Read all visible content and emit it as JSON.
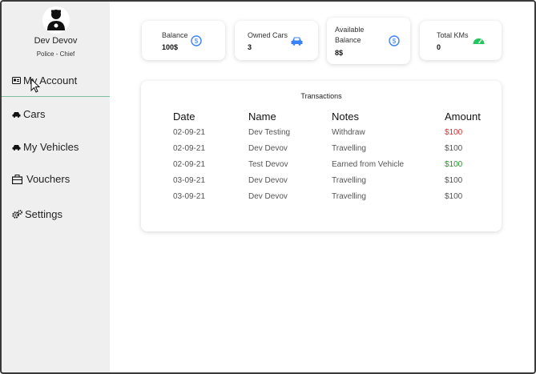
{
  "user": {
    "name": "Dev Devov",
    "role": "Police - Chief"
  },
  "sidebar": {
    "items": [
      {
        "label": "My Account",
        "icon": "id-card-icon"
      },
      {
        "label": "Cars",
        "icon": "car-icon"
      },
      {
        "label": "My Vehicles",
        "icon": "car-icon"
      },
      {
        "label": "Vouchers",
        "icon": "toolbox-icon"
      },
      {
        "label": "Settings",
        "icon": "gears-icon"
      }
    ]
  },
  "stats": [
    {
      "label": "Balance",
      "value": "100$",
      "icon": "dollar-circle-icon",
      "color": "#3b82f6"
    },
    {
      "label": "Owned Cars",
      "value": "3",
      "icon": "car-icon",
      "color": "#3b82f6"
    },
    {
      "label": "Available Balance",
      "label_line1": "Available",
      "label_line2": "Balance",
      "value": "8$",
      "icon": "dollar-circle-icon",
      "color": "#3b82f6"
    },
    {
      "label": "Total KMs",
      "value": "0",
      "icon": "speedometer-icon",
      "color": "#22c55e"
    }
  ],
  "transactions": {
    "title": "Transactions",
    "columns": [
      "Date",
      "Name",
      "Notes",
      "Amount"
    ],
    "rows": [
      {
        "date": "02-09-21",
        "name": "Dev Testing",
        "notes": "Withdraw",
        "amount": "$100",
        "status": "negative"
      },
      {
        "date": "02-09-21",
        "name": "Dev Devov",
        "notes": "Travelling",
        "amount": "$100",
        "status": "neutral"
      },
      {
        "date": "02-09-21",
        "name": "Test Devov",
        "notes": "Earned from Vehicle",
        "amount": "$100",
        "status": "positive"
      },
      {
        "date": "03-09-21",
        "name": "Dev Devov",
        "notes": "Travelling",
        "amount": "$100",
        "status": "neutral"
      },
      {
        "date": "03-09-21",
        "name": "Dev Devov",
        "notes": "Travelling",
        "amount": "$100",
        "status": "neutral"
      }
    ]
  },
  "colors": {
    "negative": "#d32f2f",
    "positive": "#2e8b2e",
    "accent": "#3b82f6",
    "green": "#22c55e"
  }
}
